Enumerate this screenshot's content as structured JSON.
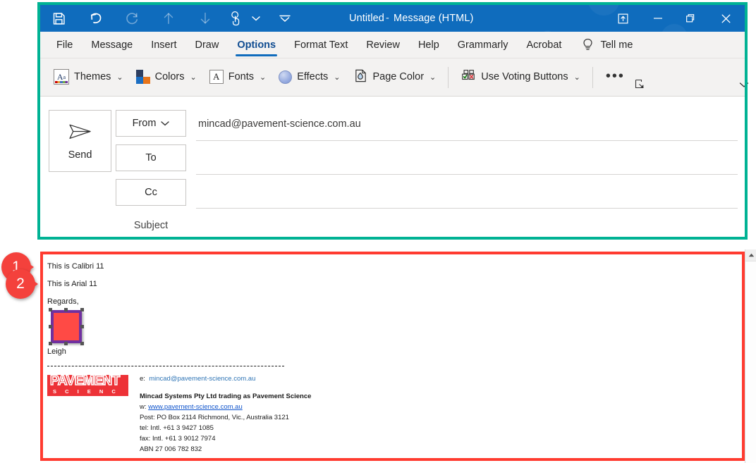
{
  "window": {
    "title_main": "Untitled",
    "title_sep": "-",
    "title_doc": "Message (HTML)",
    "accent_teal": "#00b294",
    "accent_red": "#ff3b30",
    "titlebar_blue": "#0f6cbd"
  },
  "quick_access": {
    "items": [
      {
        "name": "save-icon",
        "label": "Save"
      },
      {
        "name": "undo-icon",
        "label": "Undo"
      },
      {
        "name": "redo-icon",
        "label": "Redo"
      },
      {
        "name": "move-up-icon",
        "label": "Previous Item"
      },
      {
        "name": "move-down-icon",
        "label": "Next Item"
      },
      {
        "name": "touch-mode-icon",
        "label": "Touch/Mouse Mode"
      }
    ],
    "touch_chevron": "⌄",
    "customize_chevron": "⌄"
  },
  "window_controls": {
    "restore_ribbon": "Ribbon Display Options",
    "minimize": "Minimize",
    "maximize": "Restore Down",
    "close": "Close"
  },
  "ribbon": {
    "tabs": [
      {
        "label": "File",
        "active": false
      },
      {
        "label": "Message",
        "active": false
      },
      {
        "label": "Insert",
        "active": false
      },
      {
        "label": "Draw",
        "active": false
      },
      {
        "label": "Options",
        "active": true
      },
      {
        "label": "Format Text",
        "active": false
      },
      {
        "label": "Review",
        "active": false
      },
      {
        "label": "Help",
        "active": false
      },
      {
        "label": "Grammarly",
        "active": false
      },
      {
        "label": "Acrobat",
        "active": false
      }
    ],
    "tell_me": "Tell me",
    "tell_me_icon": "lightbulb-icon",
    "commands": [
      {
        "label": "Themes",
        "icon": "themes-icon",
        "chevron": "⌄"
      },
      {
        "label": "Colors",
        "icon": "colors-icon",
        "chevron": "⌄"
      },
      {
        "label": "Fonts",
        "icon": "fonts-icon",
        "chevron": "⌄"
      },
      {
        "label": "Effects",
        "icon": "effects-icon",
        "chevron": "⌄"
      },
      {
        "label": "Page Color",
        "icon": "page-color-icon",
        "chevron": "⌄"
      },
      {
        "label": "Use Voting Buttons",
        "icon": "voting-buttons-icon",
        "chevron": "⌄"
      }
    ],
    "overflow": "•••",
    "dialog_launcher": "dialog-box-launcher-icon",
    "collapse_chevron": "⌄"
  },
  "compose": {
    "send_label": "Send",
    "send_icon": "send-arrow-icon",
    "from_label": "From",
    "from_chevron": "⌄",
    "from_value": "mincad@pavement-science.com.au",
    "to_label": "To",
    "to_value": "",
    "cc_label": "Cc",
    "cc_value": "",
    "subject_label": "Subject",
    "subject_value": ""
  },
  "body": {
    "line1": "This is Calibri 11",
    "line2": "This is Arial 11",
    "line3": "Regards,",
    "image_placeholder": {
      "name": "inline-image-placeholder",
      "fill": "#ff4a45",
      "border": "#7030a0"
    },
    "signer": "Leigh",
    "divider": "dashed-rule"
  },
  "signature": {
    "logo_word": "PAVEMENT",
    "logo_sub": "S C I E N C E",
    "logo_bg": "#ed3237",
    "email_label": "e:",
    "email": "mincad@pavement-science.com.au",
    "company": "Mincad Systems Pty Ltd trading as Pavement Science",
    "web_label": "w:",
    "web": "www.pavement-science.com.au",
    "post": "Post: PO Box 2114 Richmond, Vic., Australia 3121",
    "tel": "tel: Intl. +61 3 9427 1085",
    "fax": "fax: Intl. +61 3 9012 7974",
    "abn": "ABN 27 006 782 832"
  },
  "annotations": [
    {
      "number": "1",
      "target": "calibri-line"
    },
    {
      "number": "2",
      "target": "arial-line"
    }
  ],
  "scrollbar": {
    "up_arrow": "scroll-up-arrow-icon"
  }
}
